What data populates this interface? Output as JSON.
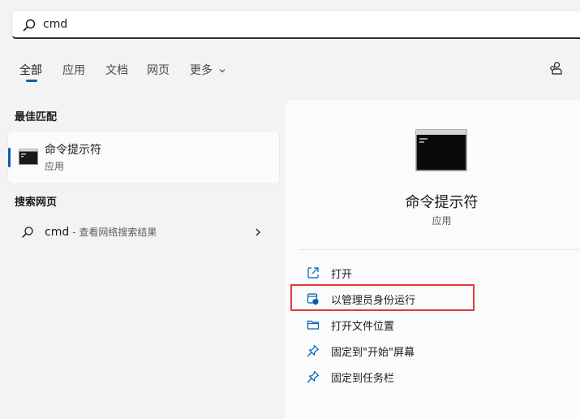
{
  "search": {
    "value": "cmd"
  },
  "tabs": [
    {
      "label": "全部"
    },
    {
      "label": "应用"
    },
    {
      "label": "文档"
    },
    {
      "label": "网页"
    },
    {
      "label": "更多"
    }
  ],
  "left": {
    "best_match_title": "最佳匹配",
    "best_match": {
      "title": "命令提示符",
      "subtitle": "应用"
    },
    "web_title": "搜索网页",
    "web": {
      "query": "cmd",
      "desc": "- 查看网络搜索结果"
    }
  },
  "right": {
    "app_name": "命令提示符",
    "app_type": "应用",
    "actions": [
      {
        "label": "打开",
        "icon": "open-icon"
      },
      {
        "label": "以管理员身份运行",
        "icon": "admin-shield-icon"
      },
      {
        "label": "打开文件位置",
        "icon": "folder-icon"
      },
      {
        "label": "固定到\"开始\"屏幕",
        "icon": "pin-icon"
      },
      {
        "label": "固定到任务栏",
        "icon": "pin-icon"
      }
    ]
  },
  "colors": {
    "accent": "#005fb8",
    "highlight": "#e53935"
  }
}
